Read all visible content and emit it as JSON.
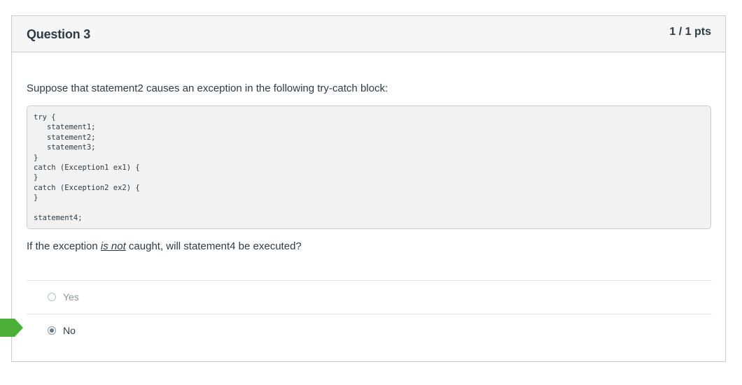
{
  "question": {
    "title": "Question 3",
    "points": "1 / 1 pts",
    "prompt": "Suppose that statement2 causes an exception in the following try-catch block:",
    "code": "try {\n   statement1;\n   statement2;\n   statement3;\n}\ncatch (Exception1 ex1) {\n}\ncatch (Exception2 ex2) {\n}\n\nstatement4;",
    "followup_before": "If the exception ",
    "followup_emphasis": "is not",
    "followup_after": " caught, will statement4 be executed?"
  },
  "answers": [
    {
      "label": "Yes",
      "selected": false
    },
    {
      "label": "No",
      "selected": true
    }
  ],
  "colors": {
    "correct_marker": "#4caf37",
    "header_bg": "#f5f5f5",
    "border": "#c7cdd1",
    "text": "#2d3b45"
  },
  "icons": {
    "correct_marker": "correct-answer-arrow-icon"
  }
}
